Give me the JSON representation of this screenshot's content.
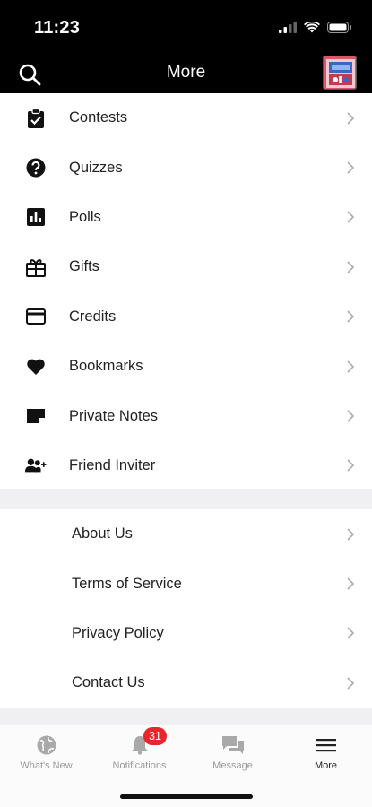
{
  "status_bar": {
    "time": "11:23"
  },
  "header": {
    "title": "More"
  },
  "primary_items": [
    {
      "label": "Contests",
      "icon": "clipboard-check-icon"
    },
    {
      "label": "Quizzes",
      "icon": "question-circle-icon"
    },
    {
      "label": "Polls",
      "icon": "bar-chart-icon"
    },
    {
      "label": "Gifts",
      "icon": "gift-icon"
    },
    {
      "label": "Credits",
      "icon": "credit-card-icon"
    },
    {
      "label": "Bookmarks",
      "icon": "heart-icon"
    },
    {
      "label": "Private Notes",
      "icon": "note-icon"
    },
    {
      "label": "Friend Inviter",
      "icon": "person-add-icon"
    }
  ],
  "secondary_items": [
    {
      "label": "About Us"
    },
    {
      "label": "Terms of Service"
    },
    {
      "label": "Privacy Policy"
    },
    {
      "label": "Contact Us"
    }
  ],
  "tab_bar": {
    "tabs": [
      {
        "label": "What's New",
        "icon": "globe-icon",
        "active": false
      },
      {
        "label": "Notifications",
        "icon": "bell-icon",
        "active": false,
        "badge": "31"
      },
      {
        "label": "Message",
        "icon": "chat-bubbles-icon",
        "active": false
      },
      {
        "label": "More",
        "icon": "hamburger-menu-icon",
        "active": true
      }
    ]
  },
  "colors": {
    "header_bg": "#000000",
    "badge": "#e8262d",
    "separator": "#f0f0f2",
    "inactive_tab": "#9a9a9a"
  }
}
